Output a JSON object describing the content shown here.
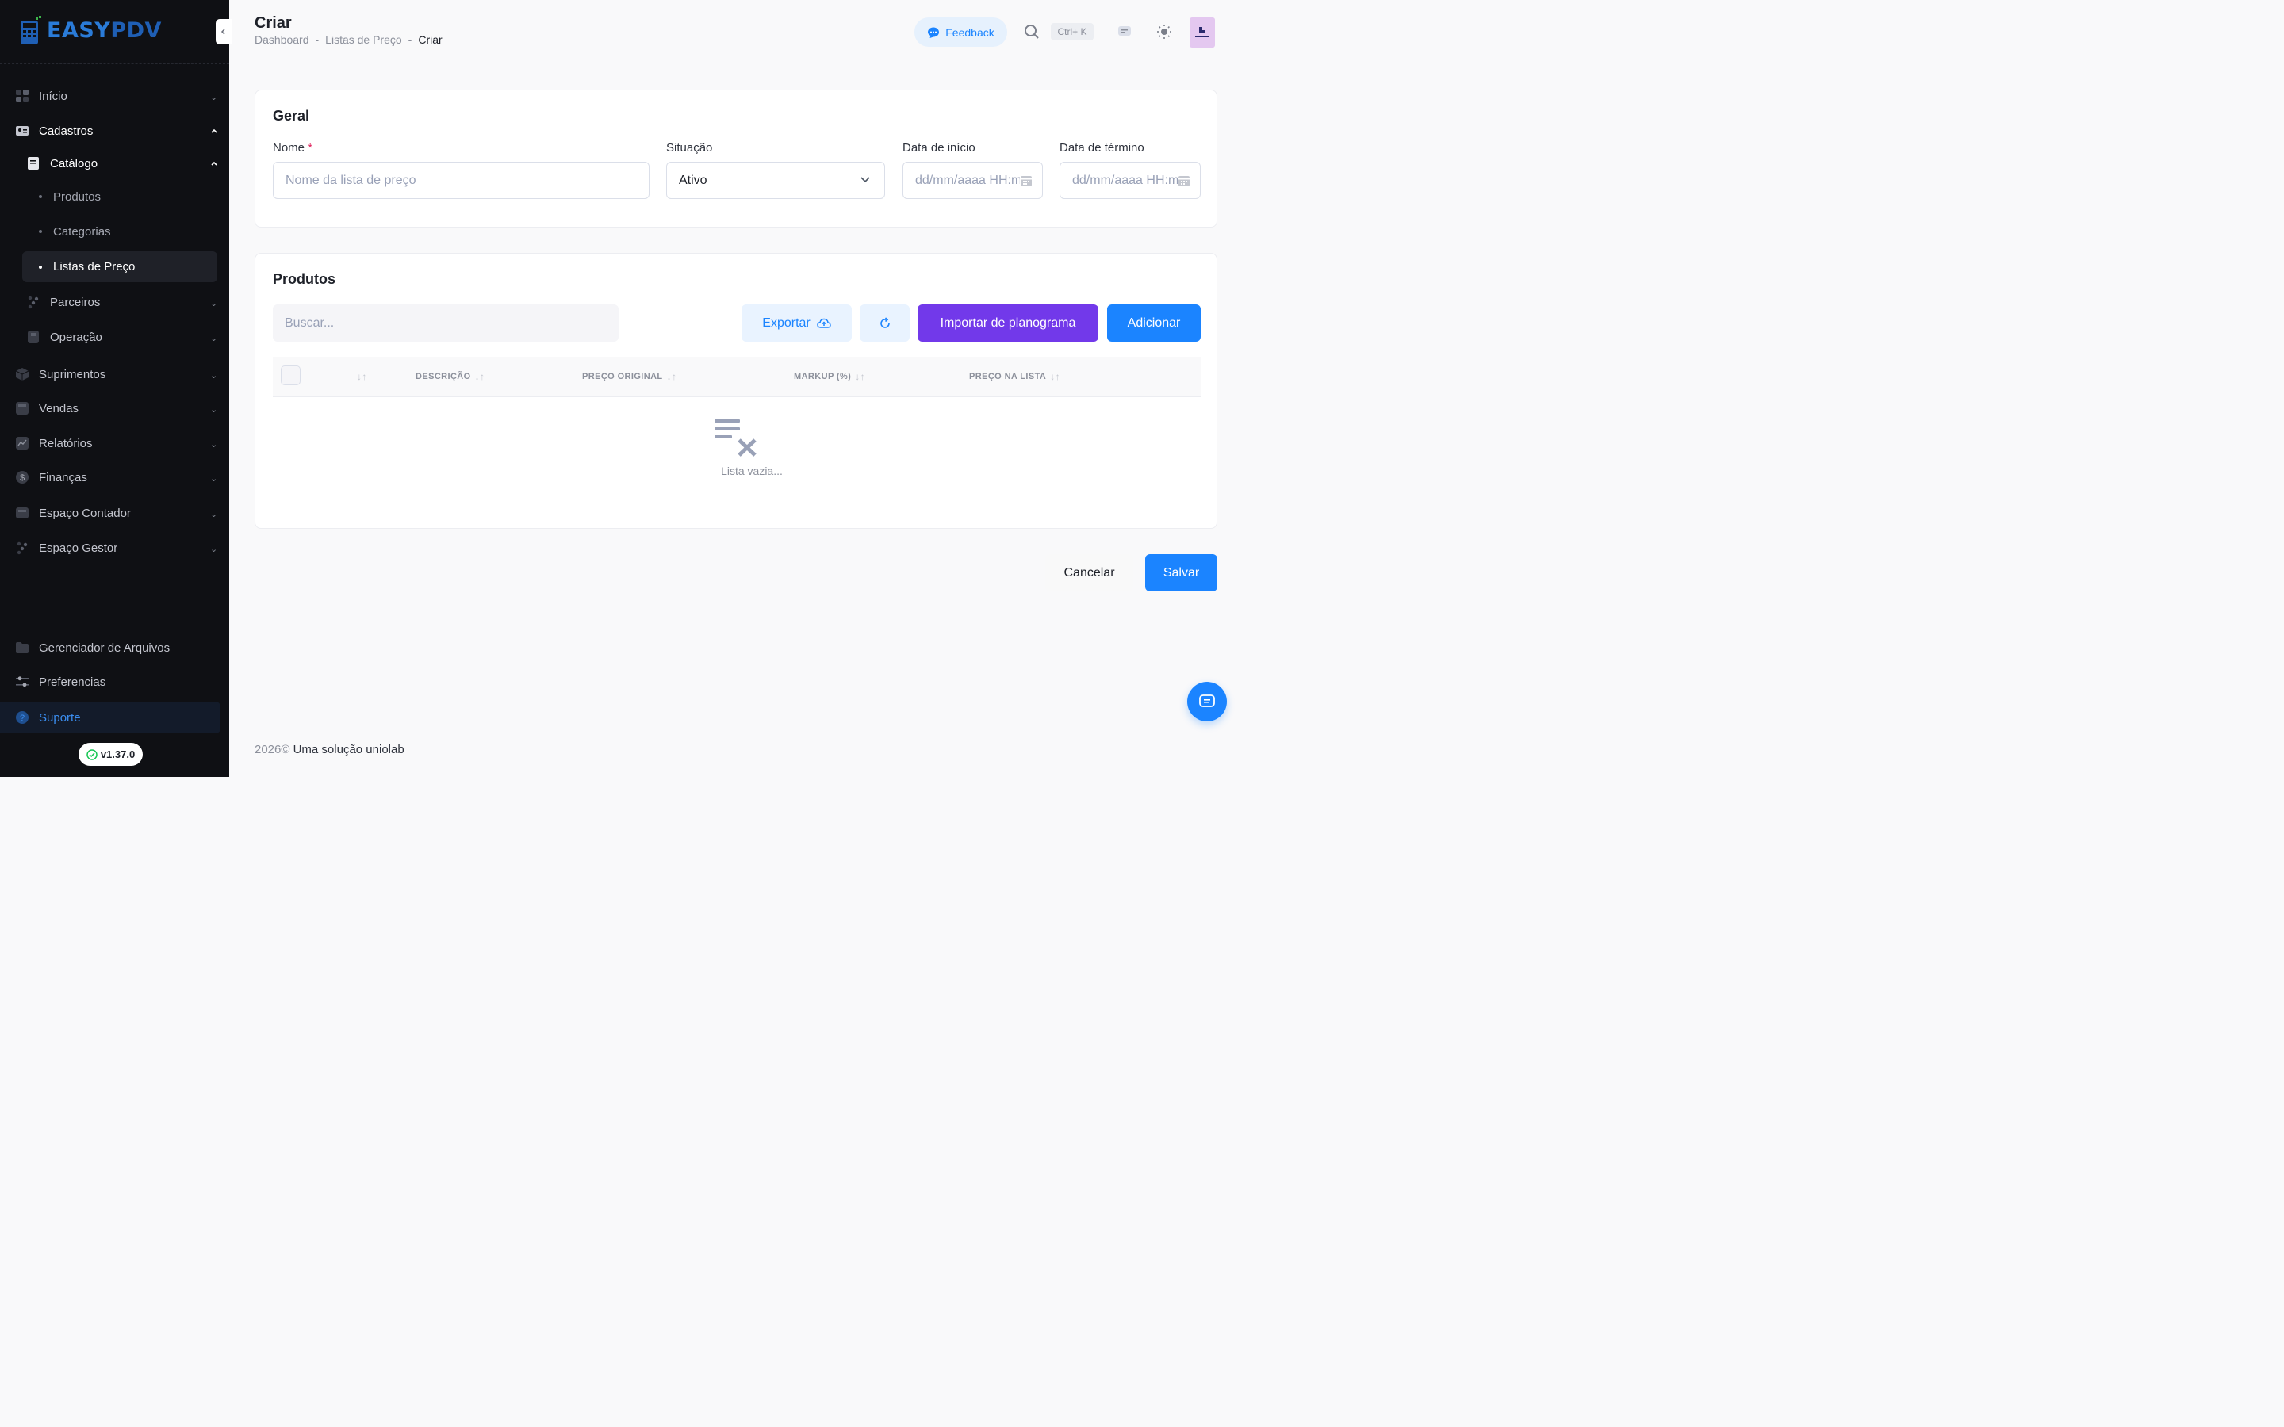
{
  "app": {
    "logo_text_a": "EASY",
    "logo_text_b": "PDV",
    "version": "v1.37.0"
  },
  "sidebar": {
    "items": [
      {
        "label": "Início"
      },
      {
        "label": "Cadastros"
      },
      {
        "label": "Catálogo"
      },
      {
        "label": "Produtos"
      },
      {
        "label": "Categorias"
      },
      {
        "label": "Listas de Preço"
      },
      {
        "label": "Parceiros"
      },
      {
        "label": "Operação"
      },
      {
        "label": "Suprimentos"
      },
      {
        "label": "Vendas"
      },
      {
        "label": "Relatórios"
      },
      {
        "label": "Finanças"
      },
      {
        "label": "Espaço Contador"
      },
      {
        "label": "Espaço Gestor"
      }
    ],
    "bottom": {
      "files": "Gerenciador de Arquivos",
      "prefs": "Preferencias",
      "support": "Suporte"
    }
  },
  "header": {
    "title": "Criar",
    "breadcrumb": [
      "Dashboard",
      "-",
      "Listas de Preço",
      "-",
      "Criar"
    ],
    "feedback": "Feedback",
    "shortcut": "Ctrl+ K"
  },
  "general": {
    "title": "Geral",
    "name_label": "Nome",
    "required_mark": "*",
    "name_placeholder": "Nome da lista de preço",
    "status_label": "Situação",
    "status_value": "Ativo",
    "start_label": "Data de início",
    "start_placeholder": "dd/mm/aaaa HH:mm",
    "end_label": "Data de término",
    "end_placeholder": "dd/mm/aaaa HH:mm"
  },
  "products": {
    "title": "Produtos",
    "search_placeholder": "Buscar...",
    "export": "Exportar",
    "import": "Importar de planograma",
    "add": "Adicionar",
    "columns": [
      "DESCRIÇÃO",
      "PREÇO ORIGINAL",
      "MARKUP (%)",
      "PREÇO NA LISTA"
    ],
    "empty": "Lista vazia..."
  },
  "actions": {
    "cancel": "Cancelar",
    "save": "Salvar"
  },
  "footer": {
    "year": "2026©",
    "brand": "Uma solução uniolab"
  },
  "colors": {
    "primary": "#1b84ff",
    "purple": "#7239ea",
    "sidebar_bg": "#0f1014"
  }
}
